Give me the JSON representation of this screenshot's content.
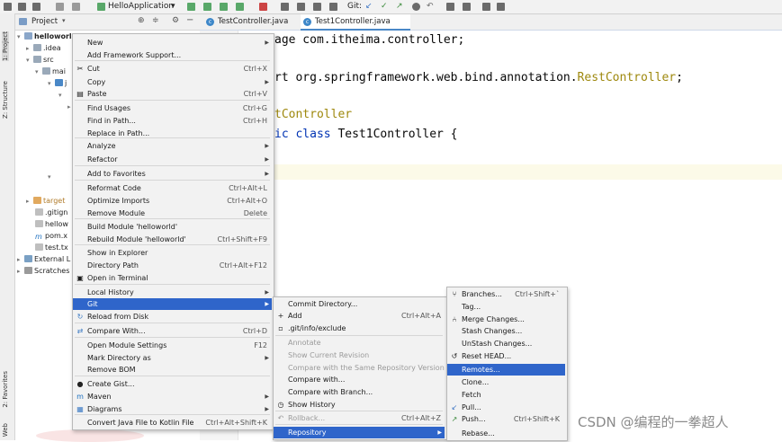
{
  "toolbar": {
    "run_config": "HelloApplication",
    "git_label": "Git:"
  },
  "left_strip": {
    "project": "1: Project",
    "structure": "Z: Structure",
    "favorites": "2: Favorites",
    "web": "Web"
  },
  "project_panel": {
    "title": "Project",
    "tree": [
      "helloworl",
      ".idea",
      "src",
      "mai",
      "j",
      "target",
      ".gitign",
      "hellow",
      "pom.x",
      "test.tx",
      "External L",
      "Scratches"
    ]
  },
  "tabs": [
    {
      "label": "TestController.java",
      "active": false
    },
    {
      "label": "Test1Controller.java",
      "active": true
    }
  ],
  "code": {
    "line1": "age com.itheima.controller;",
    "line2_a": "rt org.springframework.web.bind.annotation.",
    "line2_b": "RestController",
    "line2_c": ";",
    "line3": "tController",
    "line4_a": "ic class",
    "line4_b": " Test1Controller {"
  },
  "context_menu": {
    "items": [
      {
        "label": "New",
        "shortcut": "",
        "submenu": true
      },
      {
        "label": "Add Framework Support...",
        "shortcut": ""
      },
      {
        "label": "Cut",
        "shortcut": "Ctrl+X",
        "icon": "cut-icon"
      },
      {
        "label": "Copy",
        "shortcut": "",
        "submenu": true
      },
      {
        "label": "Paste",
        "shortcut": "Ctrl+V",
        "icon": "paste-icon"
      },
      {
        "label": "Find Usages",
        "shortcut": "Ctrl+G"
      },
      {
        "label": "Find in Path...",
        "shortcut": "Ctrl+H"
      },
      {
        "label": "Replace in Path...",
        "shortcut": ""
      },
      {
        "label": "Analyze",
        "shortcut": "",
        "submenu": true
      },
      {
        "label": "Refactor",
        "shortcut": "",
        "submenu": true
      },
      {
        "label": "Add to Favorites",
        "shortcut": "",
        "submenu": true
      },
      {
        "label": "Reformat Code",
        "shortcut": "Ctrl+Alt+L"
      },
      {
        "label": "Optimize Imports",
        "shortcut": "Ctrl+Alt+O"
      },
      {
        "label": "Remove Module",
        "shortcut": "Delete"
      },
      {
        "label": "Build Module 'helloworld'",
        "shortcut": ""
      },
      {
        "label": "Rebuild Module 'helloworld'",
        "shortcut": "Ctrl+Shift+F9"
      },
      {
        "label": "Show in Explorer",
        "shortcut": ""
      },
      {
        "label": "Directory Path",
        "shortcut": "Ctrl+Alt+F12"
      },
      {
        "label": "Open in Terminal",
        "shortcut": "",
        "icon": "terminal-icon"
      },
      {
        "label": "Local History",
        "shortcut": "",
        "submenu": true
      },
      {
        "label": "Git",
        "shortcut": "",
        "submenu": true,
        "selected": true
      },
      {
        "label": "Reload from Disk",
        "shortcut": "",
        "icon": "reload-icon"
      },
      {
        "label": "Compare With...",
        "shortcut": "Ctrl+D",
        "icon": "compare-icon"
      },
      {
        "label": "Open Module Settings",
        "shortcut": "F12"
      },
      {
        "label": "Mark Directory as",
        "shortcut": "",
        "submenu": true
      },
      {
        "label": "Remove BOM",
        "shortcut": ""
      },
      {
        "label": "Create Gist...",
        "shortcut": "",
        "icon": "github-icon"
      },
      {
        "label": "Maven",
        "shortcut": "",
        "submenu": true,
        "icon": "maven-icon"
      },
      {
        "label": "Diagrams",
        "shortcut": "",
        "submenu": true,
        "icon": "diagram-icon"
      },
      {
        "label": "Convert Java File to Kotlin File",
        "shortcut": "Ctrl+Alt+Shift+K"
      }
    ]
  },
  "git_menu": {
    "items": [
      {
        "label": "Commit Directory...",
        "shortcut": ""
      },
      {
        "label": "Add",
        "shortcut": "Ctrl+Alt+A",
        "icon": "plus-icon"
      },
      {
        "label": ".git/info/exclude",
        "shortcut": "",
        "icon": "file-icon"
      },
      {
        "label": "Annotate",
        "shortcut": "",
        "disabled": true
      },
      {
        "label": "Show Current Revision",
        "shortcut": "",
        "disabled": true
      },
      {
        "label": "Compare with the Same Repository Version",
        "shortcut": "",
        "disabled": true
      },
      {
        "label": "Compare with...",
        "shortcut": ""
      },
      {
        "label": "Compare with Branch...",
        "shortcut": ""
      },
      {
        "label": "Show History",
        "shortcut": "",
        "icon": "history-icon"
      },
      {
        "label": "Rollback...",
        "shortcut": "Ctrl+Alt+Z",
        "disabled": true,
        "icon": "rollback-icon"
      },
      {
        "label": "Repository",
        "shortcut": "",
        "submenu": true,
        "selected": true
      }
    ]
  },
  "repo_menu": {
    "items": [
      {
        "label": "Branches...",
        "shortcut": "Ctrl+Shift+`",
        "icon": "branch-icon"
      },
      {
        "label": "Tag...",
        "shortcut": ""
      },
      {
        "label": "Merge Changes...",
        "shortcut": "",
        "icon": "merge-icon"
      },
      {
        "label": "Stash Changes...",
        "shortcut": ""
      },
      {
        "label": "UnStash Changes...",
        "shortcut": ""
      },
      {
        "label": "Reset HEAD...",
        "shortcut": "",
        "icon": "reset-icon"
      },
      {
        "label": "Remotes...",
        "shortcut": "",
        "selected": true
      },
      {
        "label": "Clone...",
        "shortcut": ""
      },
      {
        "label": "Fetch",
        "shortcut": ""
      },
      {
        "label": "Pull...",
        "shortcut": "",
        "icon": "pull-icon"
      },
      {
        "label": "Push...",
        "shortcut": "Ctrl+Shift+K",
        "icon": "push-icon"
      },
      {
        "label": "Rebase...",
        "shortcut": ""
      }
    ]
  },
  "watermark": "CSDN @编程的一拳超人",
  "colors": {
    "selection": "#2f65ca",
    "keyword": "#0033b3",
    "annotation": "#9e880d"
  }
}
